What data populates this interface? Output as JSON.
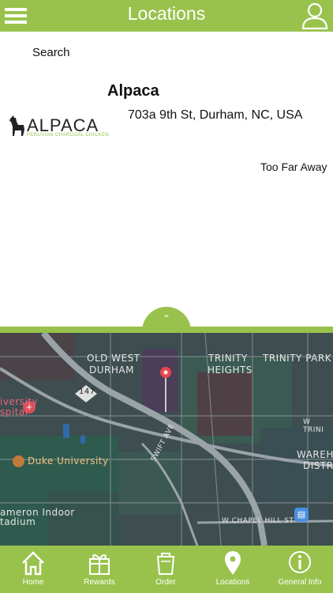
{
  "header": {
    "title": "Locations"
  },
  "search": {
    "label": "Search"
  },
  "location": {
    "logo_text": "ALPACA",
    "logo_subtext": "PERUVIAN CHARCOAL CHICKEN",
    "name": "Alpaca",
    "address": "703a 9th St, Durham, NC, USA",
    "distance": "Too Far Away"
  },
  "map": {
    "labels": {
      "old_west": "OLD WEST",
      "durham": "DURHAM",
      "trinity": "TRINITY",
      "heights": "HEIGHTS",
      "trinity_park": "TRINITY PARK",
      "university": "iversity",
      "hospital": "spital",
      "duke": "Duke University",
      "cameron1": "ameron Indoor",
      "cameron2": "tadium",
      "swift": "SWIFT AVE",
      "chapel": "W CHAPEL HILL ST",
      "wtrini": "W TRINI",
      "wareho": "WAREHO",
      "distri": "DISTRI",
      "route": "147"
    }
  },
  "tabs": [
    {
      "label": "Home"
    },
    {
      "label": "Rewards"
    },
    {
      "label": "Order"
    },
    {
      "label": "Locations"
    },
    {
      "label": "General Info"
    }
  ],
  "colors": {
    "brand": "#99c24d",
    "pin": "#e8474c"
  }
}
